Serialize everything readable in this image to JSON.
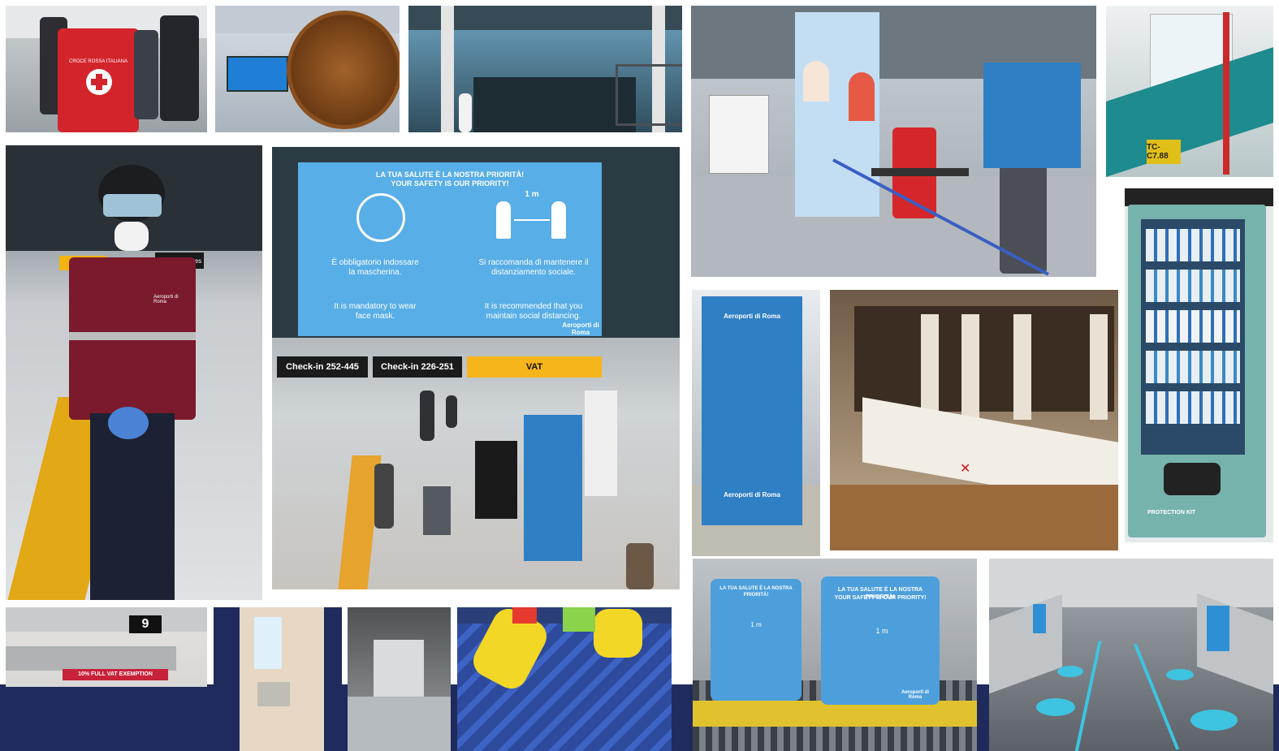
{
  "tiles": {
    "redcross": {
      "vest_text": "CROCE ROSSA ITALIANA"
    },
    "baggage": {
      "gate_number": "9",
      "floor_text": "10% FULL VAT EXEMPTION"
    },
    "main_sign": {
      "heading_it": "LA TUA SALUTE È LA NOSTRA PRIORITÀ!",
      "heading_en": "YOUR SAFETY IS OUR PRIORITY!",
      "distance": "1 m",
      "mask_it": "È obbligatorio indossare la mascherina.",
      "mask_en": "It is mandatory to wear face mask.",
      "dist_it": "Si raccomanda di mantenere il distanziamento sociale.",
      "dist_en": "It is recommended that you maintain social distancing.",
      "brand": "Aeroporti di Roma",
      "checkin_a": "Check-in 252-445",
      "checkin_b": "Check-in 226-251",
      "vat": "VAT"
    },
    "pillar": {
      "brand": "Aeroporti di Roma"
    },
    "vending": {
      "label": "PROTECTION KIT"
    },
    "counter_sign": {
      "heading_it": "LA TUA SALUTE È LA NOSTRA PRIORITÀ!",
      "heading_en": "YOUR SAFETY IS OUR PRIORITY!",
      "distance": "1 m",
      "brand": "Aeroporti di Roma"
    },
    "guard": {
      "badge": "Aeroporti di Roma",
      "sign_text": "Imbarchi Gates"
    },
    "tower": {
      "label": "TC-C7.88"
    }
  }
}
